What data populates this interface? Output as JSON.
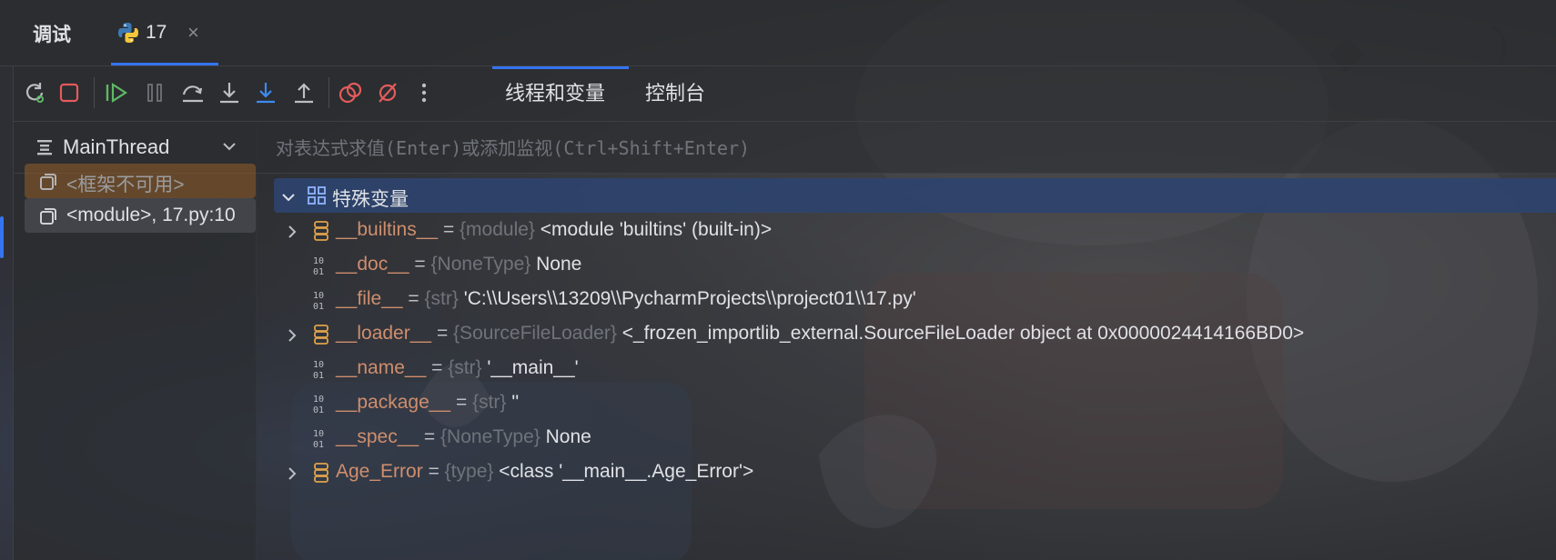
{
  "header": {
    "title": "调试",
    "tab_name": "17",
    "close_glyph": "×"
  },
  "toolbar": {
    "buttons": [
      "rerun-icon",
      "stop-icon",
      "resume-icon",
      "pause-icon",
      "step-over-icon",
      "step-into-icon",
      "step-into-my-code-icon",
      "step-out-icon",
      "view-breakpoints-icon",
      "mute-breakpoints-icon",
      "more-icon"
    ],
    "tabs": [
      "线程和变量",
      "控制台"
    ],
    "active_tab": 0
  },
  "frames": {
    "thread": "MainThread",
    "items": [
      {
        "label": "<框架不可用>",
        "state": "unavailable"
      },
      {
        "label": "<module>, 17.py:10",
        "state": "current"
      }
    ]
  },
  "eval": {
    "placeholder": "对表达式求值(Enter)或添加监视(Ctrl+Shift+Enter)"
  },
  "variables": {
    "group_label": "特殊变量",
    "items": [
      {
        "name": "__builtins__",
        "eq": "=",
        "type": "{module}",
        "value": "<module 'builtins' (built-in)>",
        "expandable": true,
        "icon": "object-icon"
      },
      {
        "name": "__doc__",
        "eq": "=",
        "type": "{NoneType}",
        "value": "None",
        "expandable": false,
        "icon": "binary-icon"
      },
      {
        "name": "__file__",
        "eq": "=",
        "type": "{str}",
        "value": "'C:\\\\Users\\\\13209\\\\PycharmProjects\\\\project01\\\\17.py'",
        "expandable": false,
        "icon": "binary-icon"
      },
      {
        "name": "__loader__",
        "eq": "=",
        "type": "{SourceFileLoader}",
        "value": "<_frozen_importlib_external.SourceFileLoader object at 0x0000024414166BD0>",
        "expandable": true,
        "icon": "object-icon"
      },
      {
        "name": "__name__",
        "eq": "=",
        "type": "{str}",
        "value": "'__main__'",
        "expandable": false,
        "icon": "binary-icon"
      },
      {
        "name": "__package__",
        "eq": "=",
        "type": "{str}",
        "value": "''",
        "expandable": false,
        "icon": "binary-icon"
      },
      {
        "name": "__spec__",
        "eq": "=",
        "type": "{NoneType}",
        "value": "None",
        "expandable": false,
        "icon": "binary-icon"
      },
      {
        "name": "Age_Error",
        "eq": "=",
        "type": "{type}",
        "value": "<class '__main__.Age_Error'>",
        "expandable": true,
        "icon": "object-icon"
      }
    ]
  },
  "colors": {
    "accent": "#3574f0",
    "var_name": "#cf8e6d",
    "type_hint": "#6f737a",
    "selection": "#2e436e"
  }
}
